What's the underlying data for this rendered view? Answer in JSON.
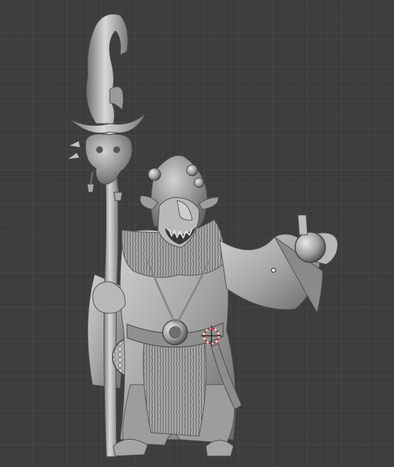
{
  "viewport": {
    "label": "3d-viewport",
    "grid": true,
    "object": "goblin-shaman-sculpt"
  },
  "colors": {
    "background": "#3d3d3d",
    "grid_minor": "#424242",
    "grid_major": "#484848",
    "model_light": "#d4d4d4",
    "model_mid": "#a8a8a8",
    "model_dark": "#5c5c5c",
    "cursor_red": "#d02020"
  },
  "icons": {
    "cursor": "3d-cursor-icon",
    "origin": "object-origin-icon"
  }
}
